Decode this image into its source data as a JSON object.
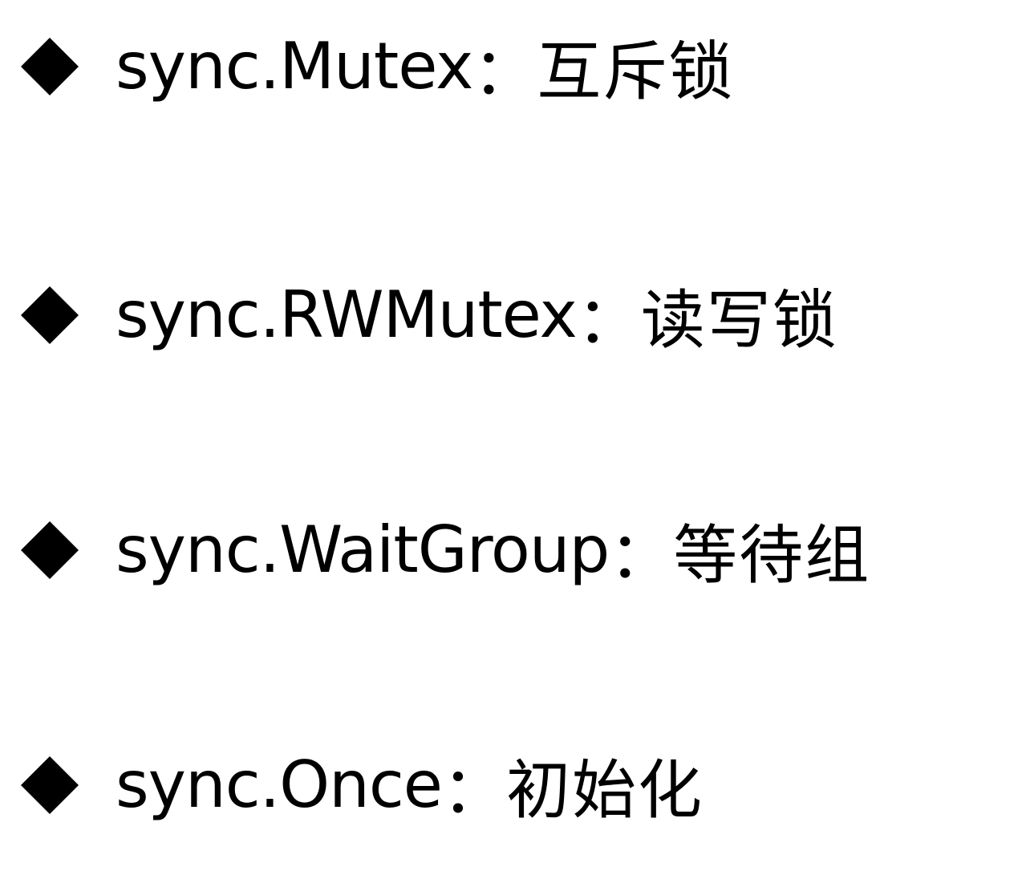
{
  "slide": {
    "items": [
      {
        "code": "sync.Mutex",
        "separator": "：",
        "description": "互斥锁"
      },
      {
        "code": "sync.RWMutex",
        "separator": "：",
        "description": "读写锁"
      },
      {
        "code": "sync.WaitGroup",
        "separator": "：",
        "description": "等待组"
      },
      {
        "code": "sync.Once",
        "separator": "：",
        "description": "初始化"
      }
    ],
    "bullet_icon": "diamond-bullet-icon",
    "text_color": "#000000",
    "background_color": "#ffffff"
  }
}
